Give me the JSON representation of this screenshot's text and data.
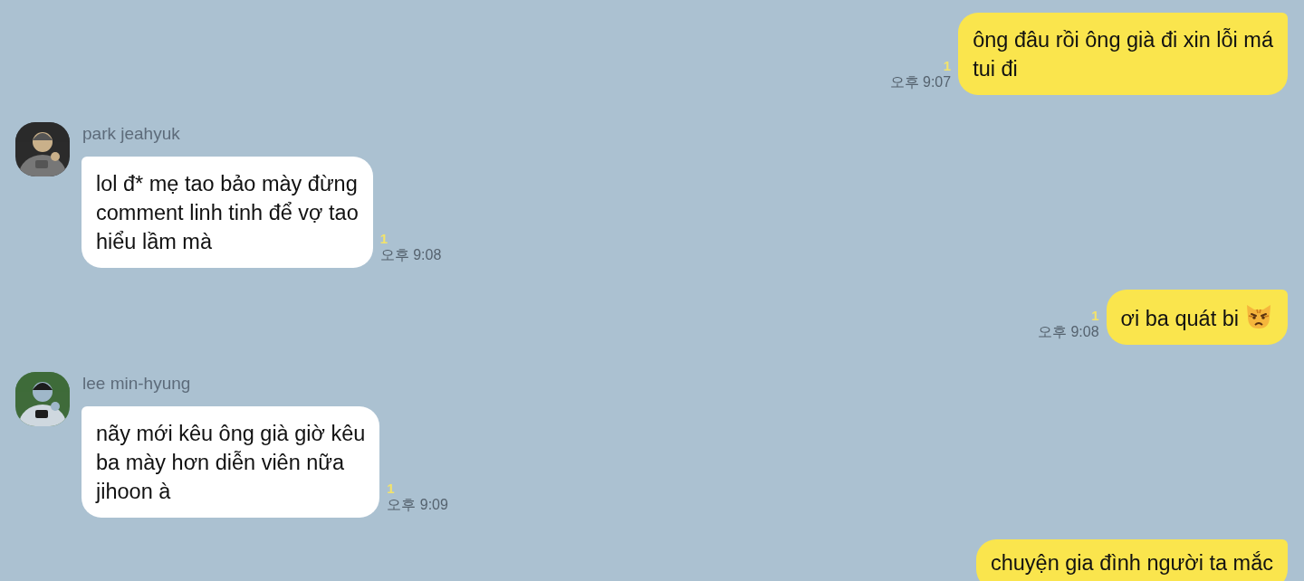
{
  "messages": [
    {
      "kind": "sent",
      "text": "ông đâu rồi ông già đi xin lỗi má\ntui đi",
      "unread": "1",
      "time": "오후 9:07"
    },
    {
      "kind": "received",
      "sender": "park jeahyuk",
      "text": "lol đ* mẹ tao bảo mày đừng\ncomment linh tinh để vợ tao\nhiểu lầm mà",
      "unread": "1",
      "time": "오후 9:08"
    },
    {
      "kind": "sent",
      "text": "ơi ba quát bi",
      "cat_icon": true,
      "unread": "1",
      "time": "오후 9:08"
    },
    {
      "kind": "received",
      "sender": "lee min-hyung",
      "text": "nãy mới kêu ông già giờ kêu\nba mày hơn diễn viên nữa\njihoon à",
      "unread": "1",
      "time": "오후 9:09"
    },
    {
      "kind": "sent",
      "text": "chuyện gia đình người ta mắc"
    }
  ]
}
